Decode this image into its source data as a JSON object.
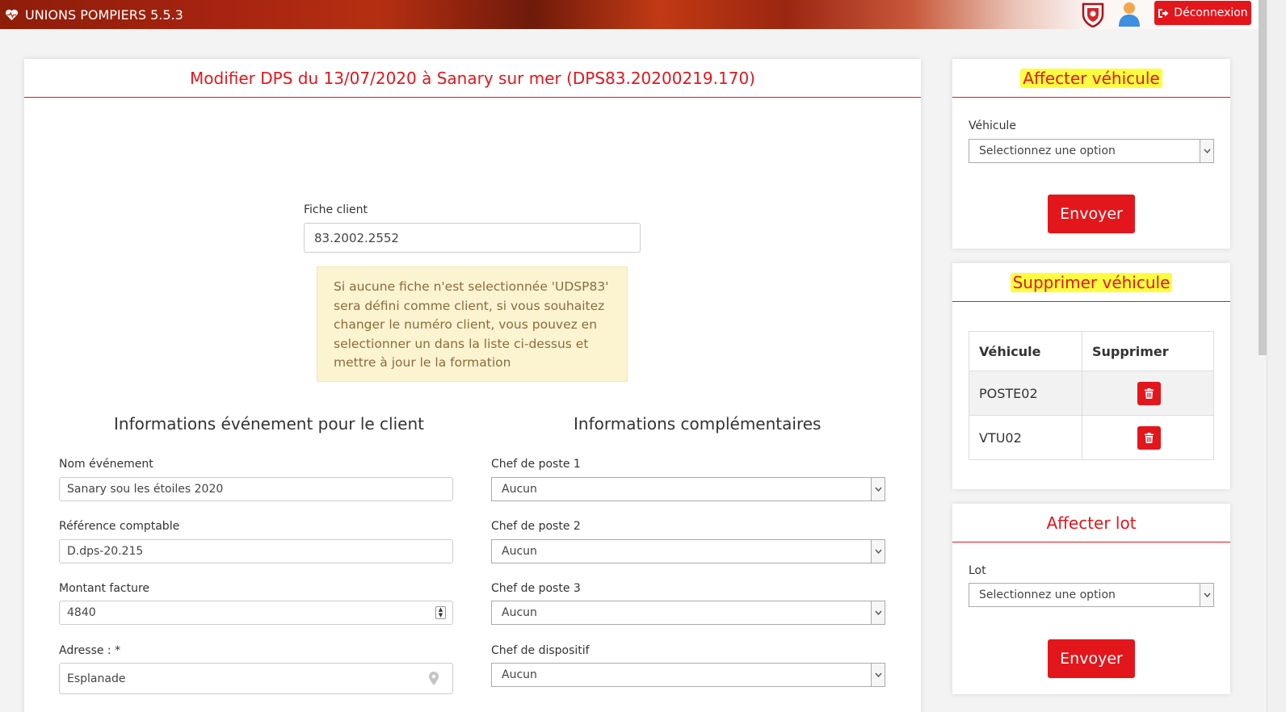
{
  "app": {
    "title": "UNIONS POMPIERS 5.5.3",
    "logout_label": "Déconnexion"
  },
  "main": {
    "title": "Modifier DPS du 13/07/2020 à Sanary sur mer (DPS83.20200219.170)",
    "fiche_client": {
      "label": "Fiche client",
      "value": "83.2002.2552"
    },
    "alert": "Si aucune fiche n'est selectionnée 'UDSP83' sera défini comme client, si vous souhaitez changer le numéro client, vous pouvez en selectionner un dans la liste ci-dessus et mettre à jour le la formation",
    "left_section": {
      "title": "Informations événement pour le client",
      "nom_label": "Nom événement",
      "nom_value": "Sanary sou les étoiles 2020",
      "ref_label": "Référence comptable",
      "ref_value": "D.dps-20.215",
      "montant_label": "Montant facture",
      "montant_value": "4840",
      "adresse_label": "Adresse : *",
      "adresse_value": "Esplanade"
    },
    "right_section": {
      "title": "Informations complémentaires",
      "chef1_label": "Chef de poste 1",
      "chef1_value": "Aucun",
      "chef2_label": "Chef de poste 2",
      "chef2_value": "Aucun",
      "chef3_label": "Chef de poste 3",
      "chef3_value": "Aucun",
      "chefdisp_label": "Chef de dispositif",
      "chefdisp_value": "Aucun"
    }
  },
  "affecter_vehicule": {
    "title": "Affecter véhicule",
    "label": "Véhicule",
    "placeholder": "Selectionnez une option",
    "button": "Envoyer"
  },
  "supprimer_vehicule": {
    "title": "Supprimer véhicule",
    "headers": [
      "Véhicule",
      "Supprimer"
    ],
    "rows": [
      "POSTE02",
      "VTU02"
    ]
  },
  "affecter_lot": {
    "title": "Affecter lot",
    "label": "Lot",
    "placeholder": "Selectionnez une option",
    "button": "Envoyer"
  },
  "colors": {
    "accent": "#e3161c",
    "highlight": "#fdfd3f",
    "alert_bg": "#fcf3d1"
  }
}
